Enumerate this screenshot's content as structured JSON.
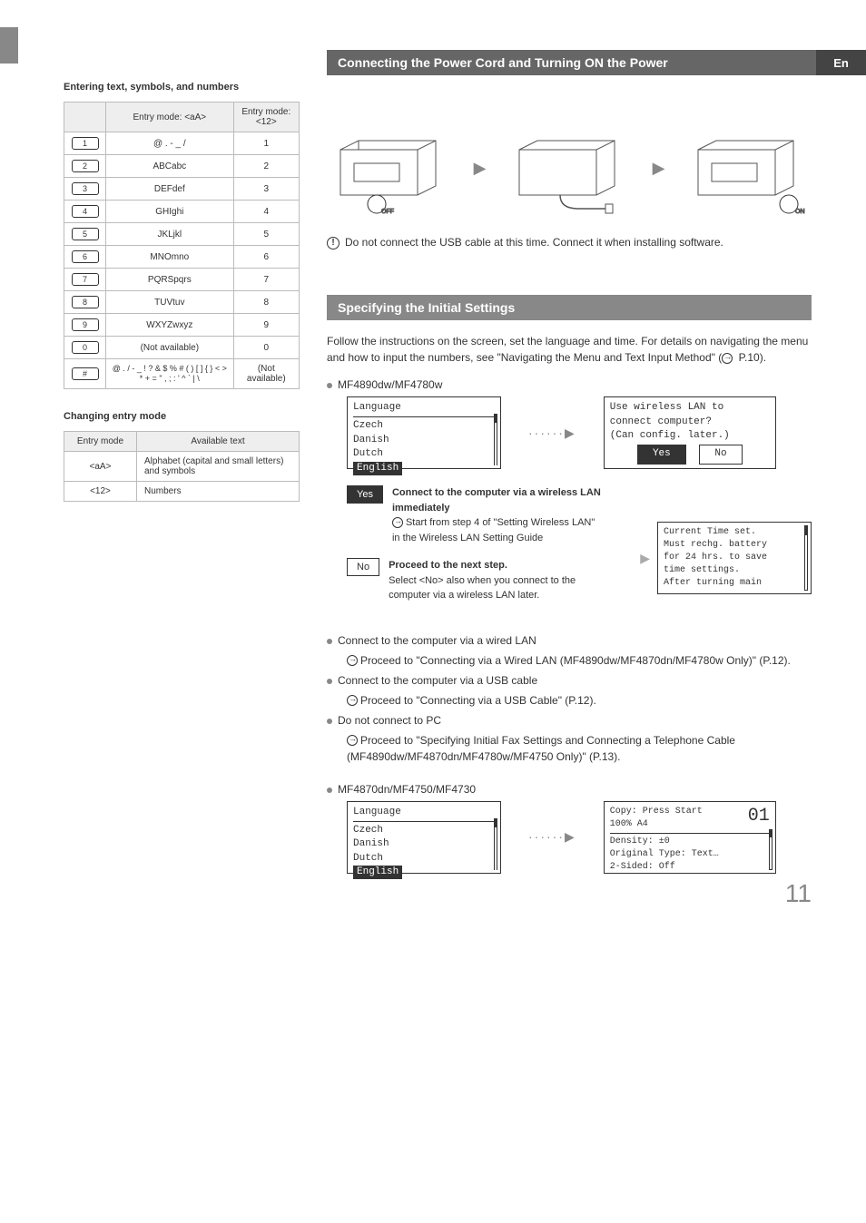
{
  "page_number": "11",
  "lang_tab": "En",
  "left": {
    "heading1": "Entering text, symbols, and numbers",
    "heading2": "Changing entry mode",
    "key_table": {
      "header_aA": "Entry mode: <aA>",
      "header_12": "Entry mode: <12>",
      "rows": [
        {
          "key": "1",
          "aA": "@ . - _ /",
          "n": "1"
        },
        {
          "key": "2",
          "aA": "ABCabc",
          "n": "2"
        },
        {
          "key": "3",
          "aA": "DEFdef",
          "n": "3"
        },
        {
          "key": "4",
          "aA": "GHIghi",
          "n": "4"
        },
        {
          "key": "5",
          "aA": "JKLjkl",
          "n": "5"
        },
        {
          "key": "6",
          "aA": "MNOmno",
          "n": "6"
        },
        {
          "key": "7",
          "aA": "PQRSpqrs",
          "n": "7"
        },
        {
          "key": "8",
          "aA": "TUVtuv",
          "n": "8"
        },
        {
          "key": "9",
          "aA": "WXYZwxyz",
          "n": "9"
        },
        {
          "key": "0",
          "aA": "(Not available)",
          "n": "0"
        },
        {
          "key": "#",
          "aA": "@ . / - _ ! ? & $ % # ( ) [ ] { } < > * + = \" , ; : ' ^ ` | \\",
          "n": "(Not available)"
        }
      ]
    },
    "mode_table": {
      "header_mode": "Entry mode",
      "header_avail": "Available text",
      "rows": [
        {
          "mode": "<aA>",
          "avail": "Alphabet (capital and small letters) and symbols"
        },
        {
          "mode": "<12>",
          "avail": "Numbers"
        }
      ]
    }
  },
  "right": {
    "section1_title": "Connecting the Power Cord and Turning ON the Power",
    "printer_off": "OFF",
    "printer_on": "ON",
    "usb_note": "Do not connect the USB cable at this time. Connect it when installing software.",
    "section2_title": "Specifying the Initial Settings",
    "intro": "Follow the instructions on the screen, set the language and time. For details on navigating the menu and how to input the numbers, see \"Navigating the Menu and Text Input Method\" (",
    "intro_ref": " P.10).",
    "model1": "MF4890dw/MF4780w",
    "lang_screen": {
      "title": "Language",
      "items": [
        "Czech",
        "Danish",
        "Dutch"
      ],
      "selected": "English"
    },
    "wlan_screen": {
      "l1": "Use wireless LAN to",
      "l2": "connect computer?",
      "l3": "(Can config. later.)",
      "yes": "Yes",
      "no": "No"
    },
    "yes_label": "Yes",
    "no_label": "No",
    "yes_opt": {
      "bold": "Connect to the computer via a wireless LAN immediately",
      "body": "Start from step 4 of \"Setting Wireless LAN\" in the Wireless LAN Setting Guide"
    },
    "no_opt": {
      "bold": "Proceed to the next step.",
      "body": "Select <No> also when you connect to the computer via a wireless LAN later."
    },
    "time_screen": {
      "l1": "Current Time set.",
      "l2": "Must rechg. battery",
      "l3": "for 24 hrs. to save",
      "l4": "time settings.",
      "l5": "After turning main"
    },
    "wired_lan": {
      "title": "Connect to the computer via a wired LAN",
      "sub": "Proceed to \"Connecting via a Wired LAN (MF4890dw/MF4870dn/MF4780w Only)\" (P.12)."
    },
    "usb": {
      "title": "Connect to the computer via a USB cable",
      "sub": "Proceed to \"Connecting via a USB Cable\" (P.12)."
    },
    "no_pc": {
      "title": "Do not connect to PC",
      "sub": "Proceed to \"Specifying Initial Fax Settings and Connecting a Telephone Cable (MF4890dw/MF4870dn/MF4780w/MF4750 Only)\" (P.13)."
    },
    "model2": "MF4870dn/MF4750/MF4730",
    "copy_screen": {
      "l1": "Copy: Press Start",
      "num": "01",
      "l2": "100%    A4",
      "l3": "Density: ±0",
      "l4": "Original Type: Text…",
      "l5": "2-Sided: Off"
    }
  }
}
